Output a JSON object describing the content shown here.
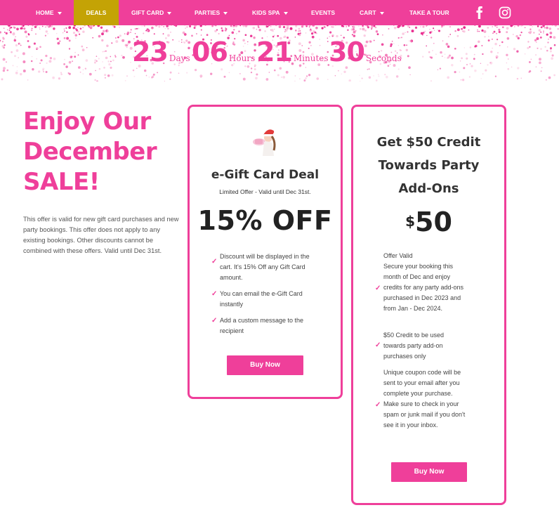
{
  "nav": {
    "items": [
      {
        "label": "HOME",
        "dropdown": true
      },
      {
        "label": "DEALS",
        "dropdown": false,
        "active": true
      },
      {
        "label": "GIFT CARD",
        "dropdown": true
      },
      {
        "label": "PARTIES",
        "dropdown": true
      },
      {
        "label": "KIDS SPA",
        "dropdown": true
      },
      {
        "label": "EVENTS",
        "dropdown": false
      },
      {
        "label": "CART",
        "dropdown": true
      },
      {
        "label": "TAKE A TOUR",
        "dropdown": false
      }
    ],
    "social": [
      "facebook-icon",
      "instagram-icon"
    ]
  },
  "countdown": {
    "days": "23",
    "days_label": "Days",
    "hours": "06",
    "hours_label": "Hours",
    "minutes": "21",
    "minutes_label": "Minutes",
    "seconds": "30",
    "seconds_label": "Seconds"
  },
  "promo": {
    "title_line1": "Enjoy Our",
    "title_line2": "December",
    "title_line3": "SALE!",
    "description": "This offer is valid for new gift card purchases and new party bookings. This offer does not apply to any existing bookings. Other discounts cannot be combined with these offers. Valid until Dec 31st."
  },
  "card1": {
    "title": "e-Gift Card Deal",
    "subtitle": "Limited Offer - Valid until Dec 31st.",
    "headline": "15% OFF",
    "features": [
      "Discount will be displayed in the cart. It's 15% Off any Gift Card amount.",
      "You can email the e-Gift Card instantly",
      "Add a custom message to the recipient"
    ],
    "button": "Buy Now"
  },
  "card2": {
    "title": "Get $50 Credit Towards Party Add-Ons",
    "currency": "$",
    "amount": "50",
    "features": [
      "Offer Valid\nSecure your booking this month of Dec and enjoy credits for any party add-ons purchased in Dec 2023 and from Jan - Dec 2024.",
      "$50 Credit to be used towards party add-on purchases only",
      "Unique coupon code will be sent to your email after you complete your purchase. Make sure to check in your spam or junk mail if you don't see it in your inbox."
    ],
    "button": "Buy Now"
  },
  "colors": {
    "brand_pink": "#ef3f9a",
    "active_nav": "#c4a305"
  }
}
